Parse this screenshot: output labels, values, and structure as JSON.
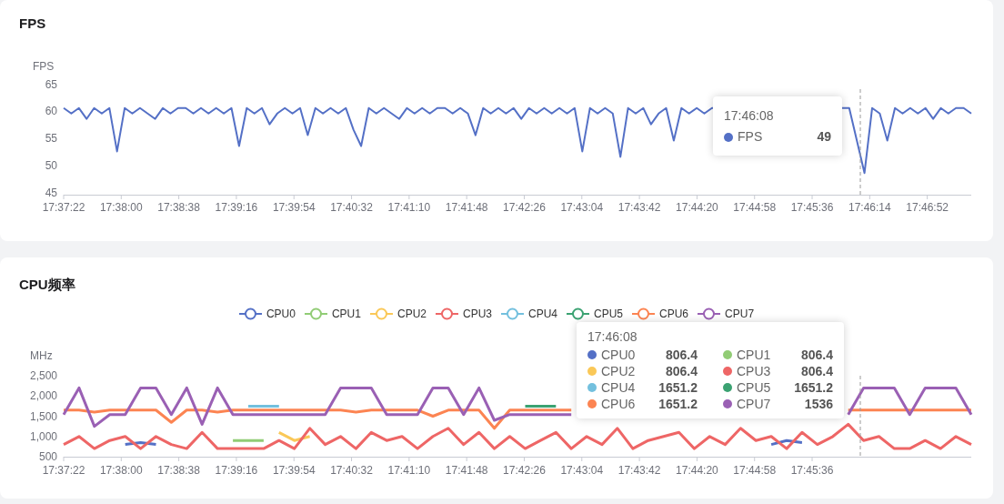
{
  "fps_panel": {
    "title": "FPS",
    "chart_data": {
      "type": "line",
      "ylabel": "FPS",
      "ylim": [
        45,
        65
      ],
      "yticks": [
        45,
        50,
        55,
        60,
        65
      ],
      "series": [
        {
          "color": "#5470c6",
          "values": [
            61,
            60,
            61,
            59,
            61,
            60,
            61,
            53,
            61,
            60,
            61,
            60,
            59,
            61,
            60,
            61,
            61,
            60,
            61,
            60,
            61,
            60,
            61,
            54,
            61,
            60,
            61,
            58,
            60,
            61,
            60,
            61,
            56,
            61,
            60,
            61,
            60,
            61,
            57,
            54,
            61,
            60,
            61,
            60,
            59,
            61,
            60,
            61,
            60,
            61,
            61,
            60,
            61,
            60,
            56,
            61,
            60,
            61,
            60,
            61,
            59,
            61,
            60,
            61,
            60,
            61,
            60,
            61,
            53,
            61,
            60,
            61,
            60,
            52,
            61,
            60,
            61,
            58,
            60,
            61,
            55,
            61,
            60,
            61,
            60,
            61,
            null,
            null,
            null,
            null,
            null,
            null,
            null,
            null,
            null,
            null,
            null,
            null,
            null,
            null,
            null,
            null,
            61,
            61,
            55,
            49,
            61,
            60,
            55,
            61,
            60,
            61,
            60,
            61,
            59,
            61,
            60,
            61,
            61,
            60
          ]
        }
      ]
    },
    "x_labels": [
      "17:37:22",
      "17:38:00",
      "17:38:38",
      "17:39:16",
      "17:39:54",
      "17:40:32",
      "17:41:10",
      "17:41:48",
      "17:42:26",
      "17:43:04",
      "17:43:42",
      "17:44:20",
      "17:44:58",
      "17:45:36",
      "17:46:14",
      "17:46:52"
    ],
    "tooltip": {
      "time": "17:46:08",
      "items": [
        {
          "name": "FPS",
          "value": "49",
          "color": "#5470c6"
        }
      ]
    }
  },
  "cpu_panel": {
    "title": "CPU频率",
    "chart_data": {
      "type": "line",
      "ylabel": "MHz",
      "ylim": [
        500,
        2500
      ],
      "yticks": [
        {
          "value": 500,
          "label": "500"
        },
        {
          "value": 1000,
          "label": "1,000"
        },
        {
          "value": 1500,
          "label": "1,500"
        },
        {
          "value": 2000,
          "label": "2,000"
        },
        {
          "value": 2500,
          "label": "2,500"
        }
      ],
      "series": [
        {
          "name": "CPU0",
          "color": "#5470c6",
          "values": [
            null,
            null,
            null,
            null,
            800,
            850,
            800,
            null,
            null,
            null,
            null,
            null,
            null,
            null,
            null,
            null,
            null,
            null,
            null,
            null,
            null,
            null,
            null,
            null,
            null,
            null,
            null,
            null,
            null,
            null,
            null,
            null,
            null,
            null,
            null,
            null,
            null,
            null,
            null,
            null,
            null,
            null,
            null,
            null,
            null,
            null,
            800,
            900,
            850,
            null,
            null,
            null,
            null,
            null,
            null,
            null,
            null,
            null,
            null,
            null
          ]
        },
        {
          "name": "CPU1",
          "color": "#91cc75",
          "values": [
            null,
            null,
            null,
            null,
            null,
            null,
            null,
            null,
            null,
            null,
            null,
            900,
            900,
            900,
            null,
            null,
            null,
            null,
            null,
            null,
            null,
            null,
            null,
            null,
            null,
            null,
            null,
            null,
            null,
            null,
            null,
            null,
            null,
            null,
            null,
            null,
            null,
            null,
            null,
            null,
            null,
            null,
            null,
            null,
            null,
            null,
            null,
            null,
            null,
            null,
            null,
            null,
            null,
            null,
            null,
            null,
            null,
            null,
            null,
            null
          ]
        },
        {
          "name": "CPU2",
          "color": "#fac858",
          "values": [
            null,
            null,
            null,
            null,
            null,
            null,
            null,
            null,
            null,
            null,
            null,
            null,
            null,
            null,
            1100,
            900,
            1000,
            null,
            null,
            null,
            null,
            null,
            null,
            null,
            null,
            null,
            null,
            null,
            null,
            null,
            null,
            null,
            null,
            null,
            null,
            null,
            null,
            null,
            null,
            null,
            null,
            null,
            null,
            null,
            null,
            null,
            null,
            null,
            null,
            null,
            null,
            null,
            null,
            null,
            null,
            null,
            null,
            null,
            null,
            null
          ]
        },
        {
          "name": "CPU3",
          "color": "#ee6666",
          "values": [
            800,
            1000,
            700,
            900,
            1000,
            700,
            1000,
            800,
            700,
            1100,
            700,
            700,
            700,
            700,
            900,
            700,
            1200,
            800,
            1000,
            700,
            1100,
            900,
            1000,
            700,
            1000,
            1200,
            800,
            1100,
            700,
            1000,
            700,
            900,
            1100,
            700,
            1000,
            800,
            1200,
            700,
            900,
            1000,
            1100,
            700,
            1000,
            800,
            1200,
            900,
            1000,
            700,
            1100,
            800,
            1000,
            1300,
            900,
            1000,
            700,
            700,
            900,
            700,
            1000,
            800
          ]
        },
        {
          "name": "CPU4",
          "color": "#73c0de",
          "values": [
            null,
            null,
            null,
            null,
            null,
            null,
            null,
            null,
            null,
            null,
            null,
            null,
            1750,
            1750,
            1750,
            null,
            null,
            null,
            null,
            null,
            null,
            null,
            null,
            null,
            null,
            null,
            null,
            null,
            null,
            null,
            null,
            null,
            null,
            null,
            null,
            null,
            null,
            null,
            null,
            null,
            null,
            null,
            null,
            null,
            null,
            null,
            null,
            null,
            null,
            null,
            null,
            null,
            null,
            null,
            null,
            null,
            null,
            null,
            null,
            null
          ]
        },
        {
          "name": "CPU5",
          "color": "#3ba272",
          "values": [
            null,
            null,
            null,
            null,
            null,
            null,
            null,
            null,
            null,
            null,
            null,
            null,
            null,
            null,
            null,
            null,
            null,
            null,
            null,
            null,
            null,
            null,
            null,
            null,
            null,
            null,
            null,
            null,
            null,
            null,
            1750,
            1750,
            1750,
            null,
            null,
            null,
            null,
            null,
            null,
            null,
            null,
            null,
            null,
            null,
            null,
            null,
            null,
            null,
            null,
            null,
            null,
            null,
            null,
            null,
            null,
            null,
            null,
            null,
            null,
            null
          ]
        },
        {
          "name": "CPU6",
          "color": "#fc8452",
          "values": [
            1650,
            1650,
            1600,
            1650,
            1650,
            1650,
            1650,
            1350,
            1650,
            1650,
            1600,
            1650,
            1650,
            1650,
            1650,
            1650,
            1650,
            1650,
            1650,
            1600,
            1650,
            1650,
            1650,
            1650,
            1500,
            1650,
            1650,
            1650,
            1200,
            1650,
            1650,
            1650,
            1650,
            1650,
            null,
            null,
            null,
            null,
            null,
            null,
            null,
            null,
            null,
            null,
            null,
            null,
            null,
            null,
            null,
            null,
            null,
            1650,
            1650,
            1650,
            1650,
            1650,
            1650,
            1650,
            1650,
            1650
          ]
        },
        {
          "name": "CPU7",
          "color": "#9a60b4",
          "values": [
            1540,
            2200,
            1250,
            1540,
            1540,
            2200,
            2200,
            1540,
            2200,
            1300,
            2200,
            1540,
            1540,
            1540,
            1540,
            1540,
            1540,
            1540,
            2200,
            2200,
            2200,
            1540,
            1540,
            1540,
            2200,
            2200,
            1540,
            2200,
            1400,
            1540,
            1540,
            1540,
            1540,
            1540,
            null,
            null,
            null,
            null,
            null,
            null,
            null,
            null,
            null,
            null,
            null,
            null,
            null,
            null,
            null,
            null,
            null,
            1540,
            2200,
            2200,
            2200,
            1540,
            2200,
            2200,
            2200,
            1540
          ]
        }
      ]
    },
    "x_labels": [
      "17:37:22",
      "17:38:00",
      "17:38:38",
      "17:39:16",
      "17:39:54",
      "17:40:32",
      "17:41:10",
      "17:41:48",
      "17:42:26",
      "17:43:04",
      "17:43:42",
      "17:44:20",
      "17:44:58",
      "17:45:36"
    ],
    "tooltip": {
      "time": "17:46:08",
      "items": [
        {
          "name": "CPU0",
          "value": "806.4",
          "color": "#5470c6"
        },
        {
          "name": "CPU1",
          "value": "806.4",
          "color": "#91cc75"
        },
        {
          "name": "CPU2",
          "value": "806.4",
          "color": "#fac858"
        },
        {
          "name": "CPU3",
          "value": "806.4",
          "color": "#ee6666"
        },
        {
          "name": "CPU4",
          "value": "1651.2",
          "color": "#73c0de"
        },
        {
          "name": "CPU5",
          "value": "1651.2",
          "color": "#3ba272"
        },
        {
          "name": "CPU6",
          "value": "1651.2",
          "color": "#fc8452"
        },
        {
          "name": "CPU7",
          "value": "1536",
          "color": "#9a60b4"
        }
      ]
    }
  }
}
